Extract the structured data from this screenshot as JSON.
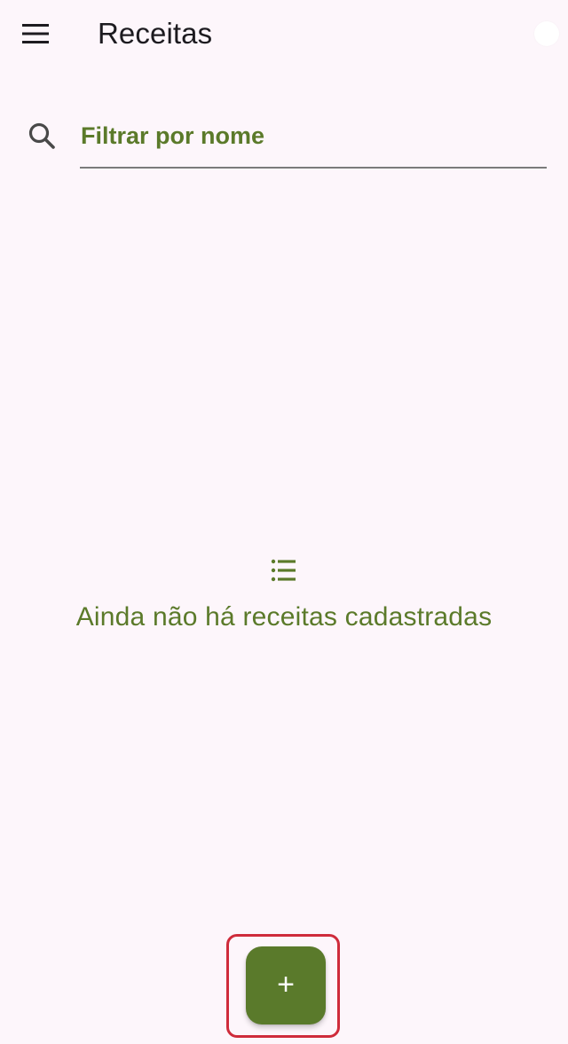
{
  "app_bar": {
    "title": "Receitas",
    "menu_icon": "menu-icon"
  },
  "search": {
    "icon": "search-icon",
    "placeholder": "Filtrar por nome"
  },
  "empty_state": {
    "icon": "list-icon",
    "message": "Ainda não há receitas cadastradas"
  },
  "fab": {
    "icon": "plus-icon",
    "label": "+"
  },
  "colors": {
    "background": "#fdf6fb",
    "primary": "#5a7a2b",
    "text": "#1d1b20",
    "focus_ring": "#cf2c3b"
  }
}
